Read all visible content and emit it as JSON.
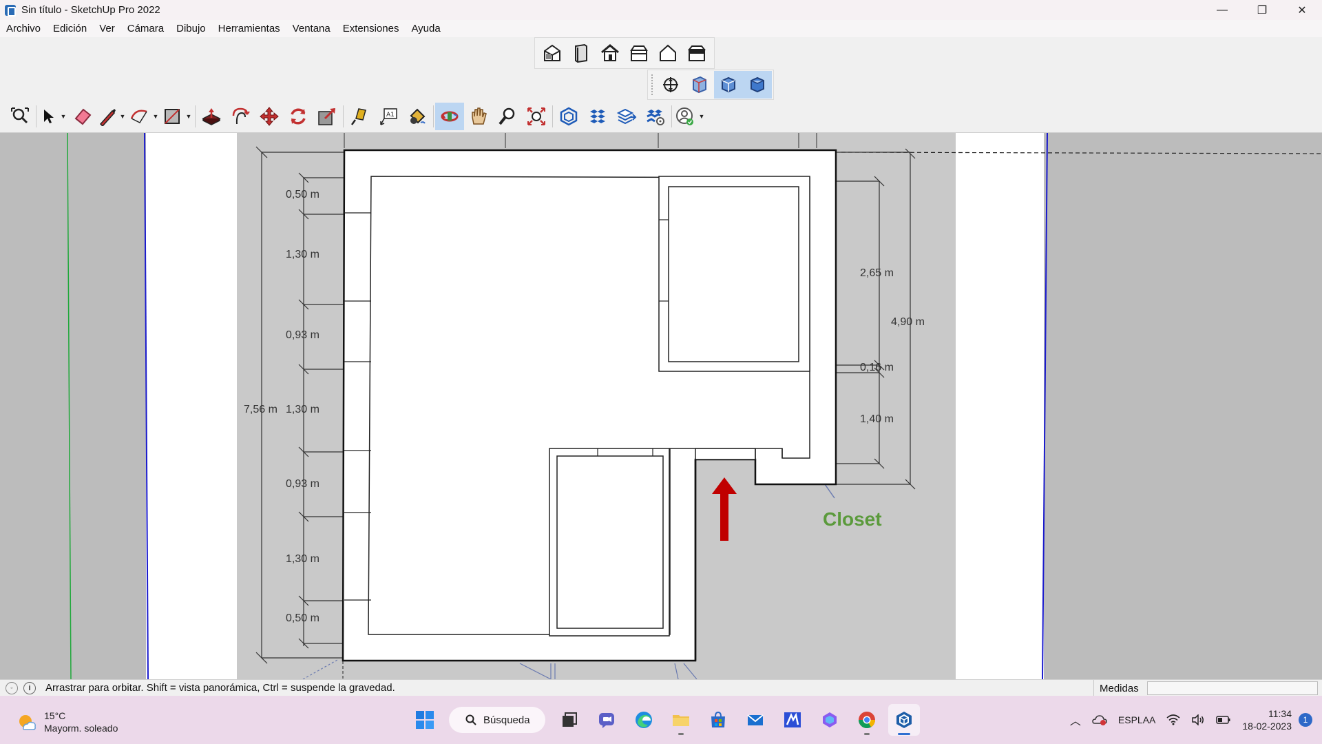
{
  "window": {
    "title": "Sin título - SketchUp Pro 2022",
    "minimize": "—",
    "restore": "❐",
    "close": "✕"
  },
  "menu": [
    "Archivo",
    "Edición",
    "Ver",
    "Cámara",
    "Dibujo",
    "Herramientas",
    "Ventana",
    "Extensiones",
    "Ayuda"
  ],
  "views_toolbar": [
    "iso-view-icon",
    "top-view-icon",
    "front-view-icon",
    "right-view-icon",
    "back-view-icon",
    "left-view-icon"
  ],
  "style_toolbar": [
    "xray-icon",
    "back-edges-icon",
    "wireframe-icon",
    "hidden-line-icon"
  ],
  "main_toolbar": [
    "zoom-extents-icon",
    "select-icon",
    "eraser-icon",
    "line-icon",
    "arc-icon",
    "rectangle-icon",
    "push-pull-icon",
    "offset-icon",
    "move-icon",
    "rotate-icon",
    "scale-icon",
    "tape-measure-icon",
    "text-icon",
    "paint-bucket-icon",
    "orbit-icon",
    "pan-icon",
    "zoom-icon",
    "zoom-window-icon",
    "warehouse-icon",
    "extension-warehouse-icon",
    "layout-icon",
    "extension-manager-icon",
    "account-icon"
  ],
  "drawing": {
    "dimensions_left": [
      "0,50 m",
      "1,30 m",
      "0,93 m",
      "1,30 m",
      "0,93 m",
      "1,30 m",
      "0,50 m"
    ],
    "total_left": "7,56 m",
    "dimensions_right": [
      "2,65 m",
      "0,16 m",
      "1,40 m"
    ],
    "total_right": "4,90 m",
    "closet_label": "Closet",
    "closet_color": "#5b9a3c",
    "arrow_color": "#c00000",
    "axis_blue": "#1a1acc",
    "axis_green": "#1fa83a"
  },
  "status": {
    "message": "Arrastrar para orbitar. Shift = vista panorámica, Ctrl = suspende la gravedad.",
    "measures_label": "Medidas",
    "measures_value": ""
  },
  "taskbar": {
    "weather_temp": "15°C",
    "weather_desc": "Mayorm. soleado",
    "search_label": "Búsqueda",
    "lang_top": "ESP",
    "lang_bottom": "LAA",
    "time": "11:34",
    "date": "18-02-2023",
    "notifications": "1"
  }
}
